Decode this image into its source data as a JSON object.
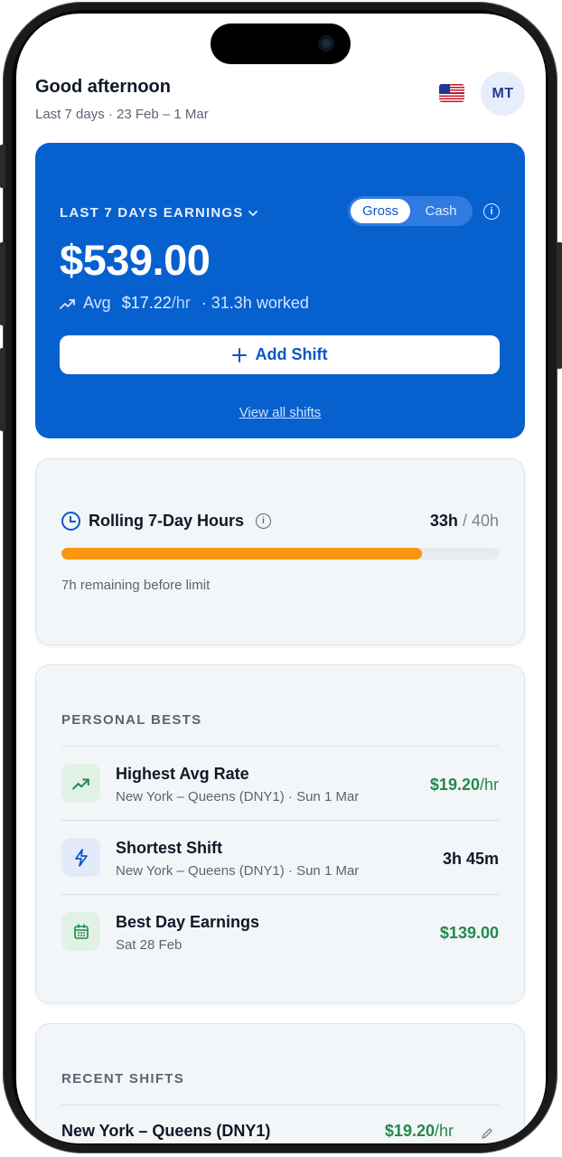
{
  "header": {
    "greeting": "Good afternoon",
    "date_range": "Last 7 days · 23 Feb – 1 Mar",
    "avatar_initials": "MT"
  },
  "earnings": {
    "label": "LAST 7 DAYS EARNINGS",
    "toggle_gross": "Gross",
    "toggle_cash": "Cash",
    "toggle_selected": "Gross",
    "amount": "$539.00",
    "avg_label": "Avg",
    "avg_rate": "$17.22",
    "avg_unit": "/hr",
    "hours_worked": "· 31.3h worked",
    "add_shift": "Add Shift",
    "view_all": "View all shifts"
  },
  "hours": {
    "title": "Rolling 7-Day Hours",
    "used": "33h",
    "limit": "/ 40h",
    "progress_fraction": 0.825,
    "note": "7h remaining before limit"
  },
  "bests": {
    "label": "PERSONAL BESTS",
    "items": [
      {
        "icon": "trending-up-icon",
        "title": "Highest Avg Rate",
        "subtitle": "New York – Queens (DNY1) · Sun 1 Mar",
        "value": "$19.20",
        "unit": "/hr"
      },
      {
        "icon": "lightning-icon",
        "title": "Shortest Shift",
        "subtitle": "New York – Queens (DNY1) · Sun 1 Mar",
        "value": "3h 45m"
      },
      {
        "icon": "calendar-icon",
        "title": "Best Day Earnings",
        "subtitle": "Sat 28 Feb",
        "value": "$139.00"
      }
    ]
  },
  "recent": {
    "label": "RECENT SHIFTS",
    "items": [
      {
        "title": "New York – Queens (DNY1)",
        "value": "$19.20",
        "unit": "/hr"
      }
    ]
  },
  "colors": {
    "brand_blue": "#0661cf",
    "progress_orange": "#f7960f",
    "positive_green": "#23894a"
  }
}
